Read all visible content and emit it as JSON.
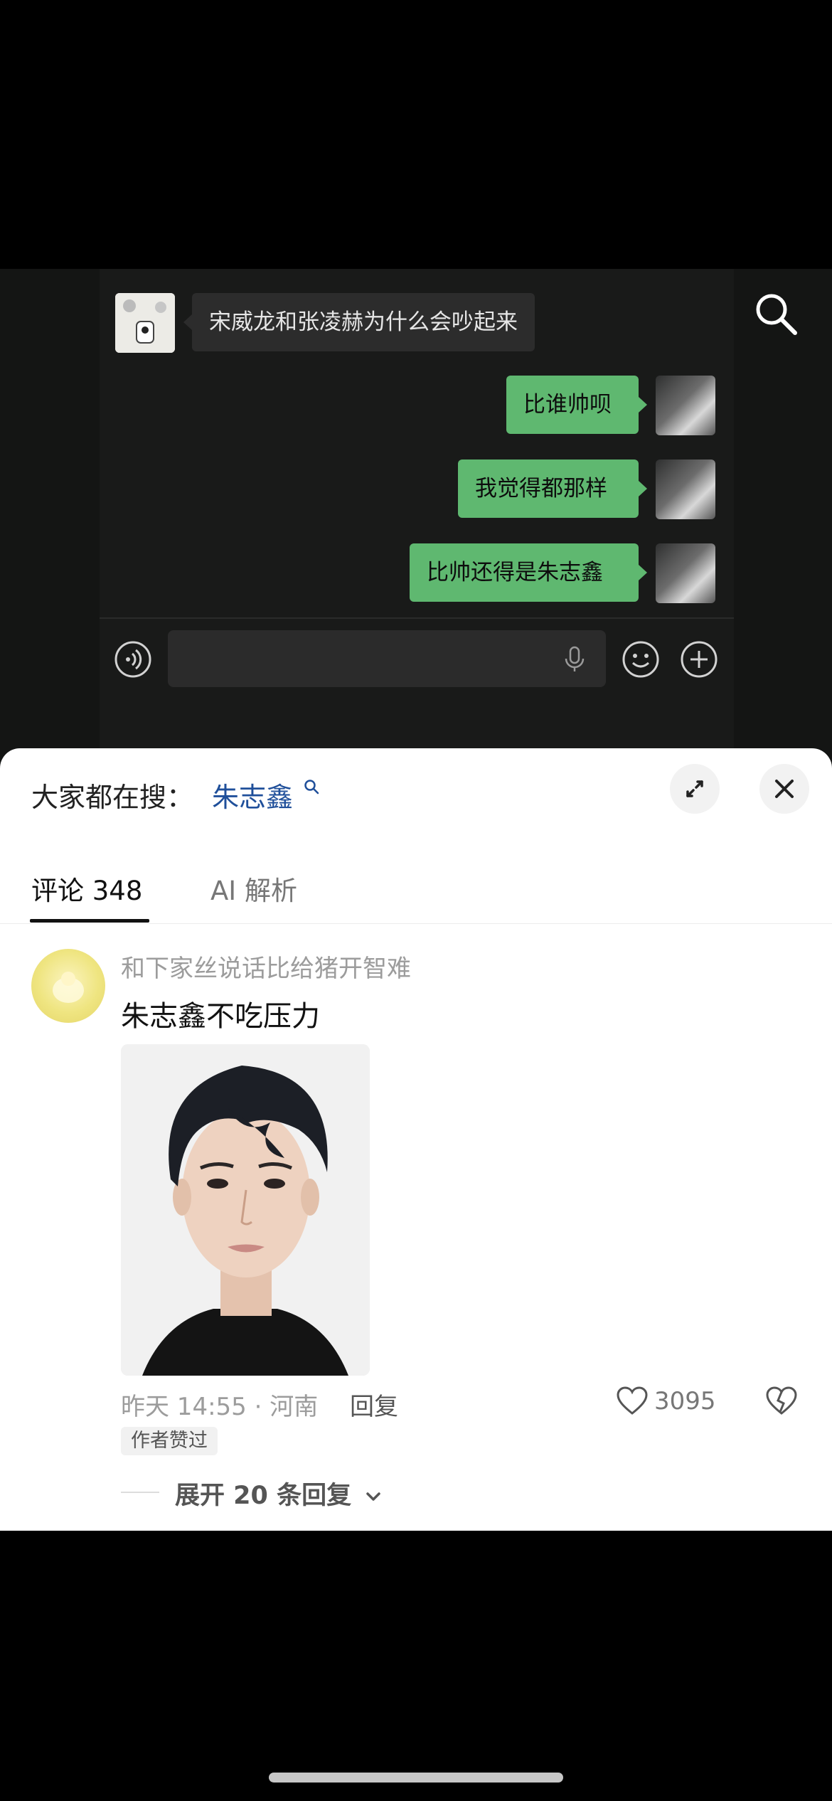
{
  "chat": {
    "incoming": "宋威龙和张凌赫为什么会吵起来",
    "outgoing": [
      "比谁帅呗",
      "我觉得都那样",
      "比帅还得是朱志鑫"
    ]
  },
  "search": {
    "prefix": "大家都在搜：",
    "term": "朱志鑫"
  },
  "tabs": [
    {
      "label": "评论 348"
    },
    {
      "label": "AI 解析"
    }
  ],
  "comment": {
    "author": "和下家丝说话比给猪开智难",
    "text": "朱志鑫不吃压力",
    "time_location": "昨天 14:55 · 河南",
    "reply_label": "回复",
    "likes": "3095",
    "badge": "作者赞过",
    "expand_label": "展开 20 条回复"
  },
  "icons": [
    "search-icon",
    "voice-icon",
    "mic-icon",
    "emoji-icon",
    "plus-icon",
    "expand-icon",
    "close-icon",
    "heart-icon",
    "dislike-icon",
    "chevron-down-icon"
  ],
  "colors": {
    "bubble_out": "#5fb870",
    "link": "#1f4f9a"
  }
}
